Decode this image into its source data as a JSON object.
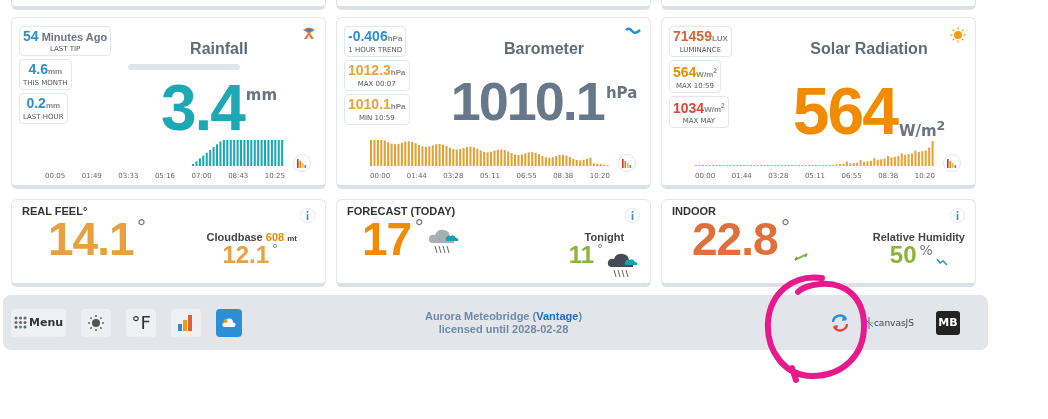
{
  "sensors": [
    {
      "kind": "rain",
      "title": "Rainfall",
      "value": "3.4",
      "unit": "mm",
      "stats": [
        {
          "value": "54",
          "unit": "Minutes Ago",
          "label": "LAST TIP",
          "color": "#2b8fd6"
        },
        {
          "value": "4.6",
          "unit": "mm",
          "label": "THIS MONTH",
          "color": "#2b8fd6"
        },
        {
          "value": "0.2",
          "unit": "mm",
          "label": "LAST HOUR",
          "color": "#2b8fd6"
        }
      ],
      "times": [
        "00:05",
        "01:49",
        "03:33",
        "05:16",
        "07:00",
        "08:43",
        "10:25"
      ]
    },
    {
      "kind": "pressure",
      "title": "Barometer",
      "value": "1010.1",
      "unit": "hPa",
      "stats": [
        {
          "value": "-0.406",
          "unit": "hPa",
          "label": "1 HOUR TREND",
          "color": "#2b8fd6"
        },
        {
          "value": "1012.3",
          "unit": "hPa",
          "label": "MAX 00:07",
          "color": "#e8a33a"
        },
        {
          "value": "1010.1",
          "unit": "hPa",
          "label": "MIN 10:59",
          "color": "#e8a33a"
        }
      ],
      "times": [
        "00:00",
        "01:44",
        "03:28",
        "05:11",
        "06:55",
        "08:38",
        "10:20"
      ]
    },
    {
      "kind": "solar",
      "title": "Solar Radiation",
      "value": "564",
      "unit": "W/m$^{2}$",
      "stats": [
        {
          "value": "71459",
          "unit": "LUX",
          "label": "LUMINANCE",
          "color": "#d8643a"
        },
        {
          "value": "564",
          "unit": "W/m$^{2}$",
          "label": "MAX 10:59",
          "color": "#f08c00"
        },
        {
          "value": "1034",
          "unit": "W/m$^{2}$",
          "label": "MAX MAY",
          "color": "#d9473a"
        }
      ],
      "times": [
        "00:00",
        "01:44",
        "03:28",
        "05:11",
        "06:55",
        "08:38",
        "10:20"
      ]
    }
  ],
  "panels": [
    {
      "kind": "realfeel",
      "title": "REAL FEEL°",
      "value": "14.1",
      "symbol": "°",
      "side_label": "Cloudbase",
      "side_value": "608",
      "side_unit": "mt",
      "side_main": "12.1",
      "side_symbol": "°"
    },
    {
      "kind": "forecast",
      "title": "FORECAST (TODAY)",
      "value": "17",
      "symbol": "°",
      "side_label": "Tonight",
      "side_main": "11",
      "side_symbol": "°"
    },
    {
      "kind": "indoor",
      "title": "INDOOR",
      "value": "22.8",
      "symbol": "°",
      "side_label": "Relative Humidity",
      "side_main": "50",
      "side_symbol": "%"
    }
  ],
  "footer": {
    "menu_label": "Menu",
    "unit_label": "°F",
    "credit_prefix": "Aurora Meteobridge (",
    "credit_link": "Vantage",
    "credit_suffix": ")",
    "license": "licensed until 2028-02-28",
    "chart_logo": "canvasJS",
    "mb_logo": "MB"
  }
}
